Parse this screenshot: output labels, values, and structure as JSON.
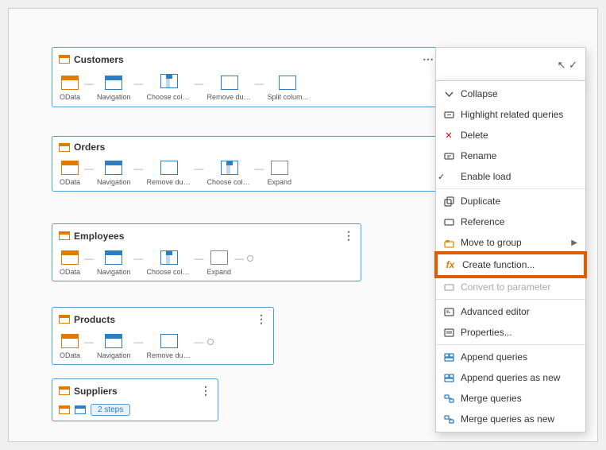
{
  "cards": {
    "customers": {
      "title": "Customers",
      "steps": [
        "OData",
        "Navigation",
        "Choose colum...",
        "Remove duplicat...",
        "Split colum..."
      ]
    },
    "orders": {
      "title": "Orders",
      "steps": [
        "OData",
        "Navigation",
        "Remove duplicat...",
        "Choose columns",
        "Expand"
      ]
    },
    "employees": {
      "title": "Employees",
      "steps": [
        "OData",
        "Navigation",
        "Choose columns",
        "Expand"
      ]
    },
    "products": {
      "title": "Products",
      "steps": [
        "OData",
        "Navigation",
        "Remove duplicat..."
      ]
    },
    "suppliers": {
      "title": "Suppliers",
      "badge": "2 steps"
    }
  },
  "context_menu": {
    "items": [
      {
        "id": "collapse",
        "label": "Collapse",
        "icon": "collapse",
        "disabled": false,
        "checked": false,
        "has_sub": false
      },
      {
        "id": "highlight",
        "label": "Highlight related queries",
        "icon": "highlight",
        "disabled": false,
        "checked": false,
        "has_sub": false
      },
      {
        "id": "delete",
        "label": "Delete",
        "icon": "delete",
        "disabled": false,
        "checked": false,
        "has_sub": false
      },
      {
        "id": "rename",
        "label": "Rename",
        "icon": "rename",
        "disabled": false,
        "checked": false,
        "has_sub": false
      },
      {
        "id": "enableload",
        "label": "Enable load",
        "icon": "",
        "disabled": false,
        "checked": true,
        "has_sub": false
      },
      {
        "id": "sep1",
        "label": "",
        "separator": true
      },
      {
        "id": "duplicate",
        "label": "Duplicate",
        "icon": "duplicate",
        "disabled": false,
        "checked": false,
        "has_sub": false
      },
      {
        "id": "reference",
        "label": "Reference",
        "icon": "reference",
        "disabled": false,
        "checked": false,
        "has_sub": false
      },
      {
        "id": "movetogroup",
        "label": "Move to group",
        "icon": "movetogroup",
        "disabled": false,
        "checked": false,
        "has_sub": true
      },
      {
        "id": "createfunction",
        "label": "Create function...",
        "icon": "createfn",
        "disabled": false,
        "checked": false,
        "has_sub": false,
        "highlighted": true
      },
      {
        "id": "convertparam",
        "label": "Convert to parameter",
        "icon": "convert",
        "disabled": true,
        "checked": false,
        "has_sub": false
      },
      {
        "id": "sep2",
        "label": "",
        "separator": true
      },
      {
        "id": "advancededitor",
        "label": "Advanced editor",
        "icon": "advanced",
        "disabled": false,
        "checked": false,
        "has_sub": false
      },
      {
        "id": "properties",
        "label": "Properties...",
        "icon": "properties",
        "disabled": false,
        "checked": false,
        "has_sub": false
      },
      {
        "id": "sep3",
        "label": "",
        "separator": true
      },
      {
        "id": "appendqueries",
        "label": "Append queries",
        "icon": "append",
        "disabled": false,
        "checked": false,
        "has_sub": false
      },
      {
        "id": "appendqueriesnew",
        "label": "Append queries as new",
        "icon": "append",
        "disabled": false,
        "checked": false,
        "has_sub": false
      },
      {
        "id": "mergequeries",
        "label": "Merge queries",
        "icon": "merge",
        "disabled": false,
        "checked": false,
        "has_sub": false
      },
      {
        "id": "mergequeriesnew",
        "label": "Merge queries as new",
        "icon": "merge",
        "disabled": false,
        "checked": false,
        "has_sub": false
      }
    ],
    "top_partial": [
      "↖",
      "✓"
    ]
  }
}
